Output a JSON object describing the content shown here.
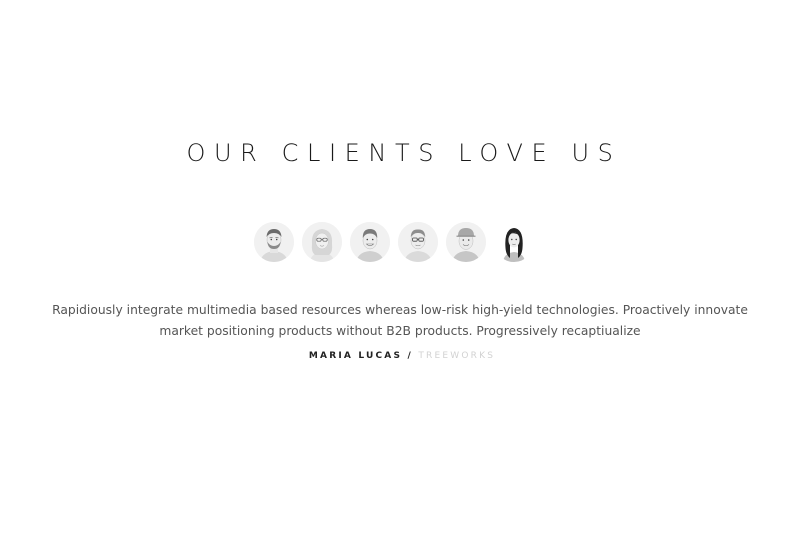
{
  "section": {
    "heading": "OUR CLIENTS LOVE US"
  },
  "avatars": [
    {
      "icon": "man-beard-avatar-icon"
    },
    {
      "icon": "woman-glasses-avatar-icon"
    },
    {
      "icon": "man-smiling-avatar-icon"
    },
    {
      "icon": "man-glasses-avatar-icon"
    },
    {
      "icon": "man-cap-avatar-icon"
    },
    {
      "icon": "woman-dark-hair-avatar-icon"
    }
  ],
  "testimonial": {
    "quote": "Rapidiously integrate multimedia based resources whereas low-risk high-yield technologies. Proactively innovate market positioning products without B2B products. Progressively recaptiualize",
    "author_name": "MARIA LUCAS",
    "separator": "/",
    "company": "TREEWORKS"
  },
  "colors": {
    "heading": "#1a1a1a",
    "quote_text": "#555555",
    "author": "#222222",
    "company": "#d2d2d2",
    "avatar_bg": "#f1f1f1"
  }
}
